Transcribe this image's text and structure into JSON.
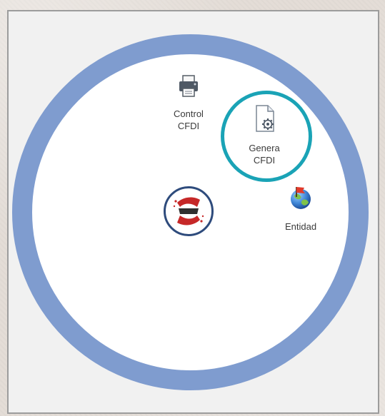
{
  "apps": {
    "control_cfdi": {
      "label": "Control\nCFDI",
      "icon": "printer-icon"
    },
    "genera_cfdi": {
      "label": "Genera\nCFDI",
      "icon": "document-gear-icon"
    },
    "entidad": {
      "label": "Entidad",
      "icon": "globe-flag-icon"
    },
    "logo": {
      "icon": "app-logo-icon"
    }
  },
  "colors": {
    "outer_ring": "#7f9ccf",
    "highlight_ring": "#1aa3b6",
    "window_bg": "#f1f1f1",
    "logo_red": "#c62828",
    "logo_dark": "#2f2f2f"
  }
}
